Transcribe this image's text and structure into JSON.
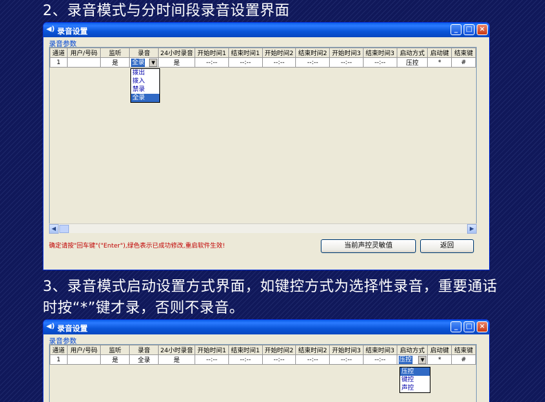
{
  "heading2": "2、录音模式与分时间段录音设置界面",
  "heading3": "3、录音模式启动设置方式界面，如键控方式为选择性录音，重要通话时按“*”键才录，否则不录音。",
  "window": {
    "title": "录音设置",
    "group_label": "录音参数",
    "minimize": "_",
    "maximize": "□",
    "close": "×"
  },
  "table": {
    "headers": [
      "通道",
      "用户/号码",
      "监听",
      "录音",
      "24小时录音",
      "开始时间1",
      "结束时间1",
      "开始时间2",
      "结束时间2",
      "开始时间3",
      "结束时间3",
      "启动方式",
      "启动键",
      "结束键"
    ],
    "row1": {
      "channel": "1",
      "user": "",
      "monitor": "是",
      "record": "全录",
      "h24": "是",
      "t1": "--:--",
      "t2": "--:--",
      "t3": "--:--",
      "t4": "--:--",
      "t5": "--:--",
      "t6": "--:--",
      "start_mode": "压控",
      "start_key": "*",
      "end_key": "#"
    }
  },
  "record_options": [
    "拨出",
    "拨入",
    "禁录",
    "全录"
  ],
  "start_mode_options": [
    "压控",
    "键控",
    "声控"
  ],
  "hint": "确定请按\"回车键\"(\"Enter\"),绿色表示已成功修改,重启软件生效!",
  "buttons": {
    "sensitivity": "当前声控灵敏值",
    "back": "返回"
  },
  "colors": {
    "background": "#10185a",
    "titlebar": "#0a55d8",
    "selection": "#316ac5",
    "hint": "#c00000"
  }
}
